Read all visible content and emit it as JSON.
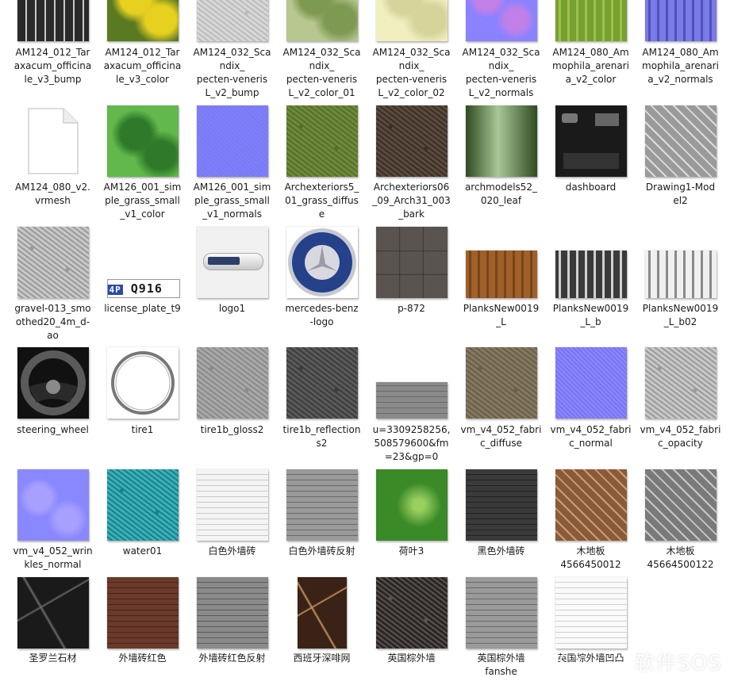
{
  "watermark": "软件SOS",
  "files": [
    {
      "n": "AM124_012_Taraxacum_officinale_v3_bump",
      "c": [
        "AM124_012_Tar",
        "axacum_officina",
        "le_v3_bump"
      ],
      "t": "dark",
      "th": [
        "#2a2a2a",
        "#c9c9c9"
      ]
    },
    {
      "n": "AM124_012_Taraxacum_officinale_v3_color",
      "c": [
        "AM124_012_Tar",
        "axacum_officina",
        "le_v3_color"
      ],
      "t": "leaf",
      "th": [
        "#5a7a22",
        "#e8d020"
      ]
    },
    {
      "n": "AM124_032_Scandix_pecten-veneris_L_v2_bump",
      "c": [
        "AM124_032_Sca",
        "ndix_",
        "pecten-veneris",
        "L_v2_bump"
      ],
      "t": "noise",
      "th": [
        "#d8d8d8",
        "#bcbcbc"
      ]
    },
    {
      "n": "AM124_032_Scandix_pecten-veneris_L_v2_color_01",
      "c": [
        "AM124_032_Sca",
        "ndix_",
        "pecten-veneris",
        "L_v2_color_01"
      ],
      "t": "leaf",
      "th": [
        "#b8c690",
        "#7e9a52"
      ]
    },
    {
      "n": "AM124_032_Scandix_pecten-veneris_L_v2_color_02",
      "c": [
        "AM124_032_Sca",
        "ndix_",
        "pecten-veneris",
        "L_v2_color_02"
      ],
      "t": "leaf",
      "th": [
        "#f1efc0",
        "#d6d49a"
      ]
    },
    {
      "n": "AM124_032_Scandix_pecten-veneris_L_v2_normals",
      "c": [
        "AM124_032_Sca",
        "ndix_",
        "pecten-veneris",
        "L_v2_normals"
      ],
      "t": "normal",
      "th": [
        "#8a82ff",
        "#c080e8"
      ]
    },
    {
      "n": "AM124_080_Ammophila_arenaria_v2_color",
      "c": [
        "AM124_080_Am",
        "mophila_arenari",
        "a_v2_color"
      ],
      "t": "stripes",
      "th": [
        "#78a030",
        "#9ac24a"
      ]
    },
    {
      "n": "AM124_080_Ammophila_arenaria_v2_normals",
      "c": [
        "AM124_080_Am",
        "mophila_arenari",
        "a_v2_normals"
      ],
      "t": "stripes",
      "th": [
        "#7a7ae8",
        "#5050b8"
      ]
    },
    {
      "n": "AM124_080_v2.vrmesh",
      "c": [
        "AM124_080_v2.",
        "vrmesh"
      ],
      "t": "file",
      "th": [
        "#ffffff",
        "#dddddd"
      ]
    },
    {
      "n": "AM126_001_simple_grass_small_v1_color",
      "c": [
        "AM126_001_sim",
        "ple_grass_small",
        "_v1_color"
      ],
      "t": "leaf",
      "th": [
        "#62b84a",
        "#2f7a2a"
      ]
    },
    {
      "n": "AM126_001_simple_grass_small_v1_normals",
      "c": [
        "AM126_001_sim",
        "ple_grass_small",
        "_v1_normals"
      ],
      "t": "flat",
      "th": [
        "#8080ff",
        "#7a7af2"
      ]
    },
    {
      "n": "Archexteriors5_01_grass_diffuse",
      "c": [
        "Archexteriors5_",
        "01_grass_diffus",
        "e"
      ],
      "t": "noise",
      "th": [
        "#6f8a3a",
        "#55702a"
      ]
    },
    {
      "n": "Archexteriors06_09_Arch31_003_bark",
      "c": [
        "Archexteriors06",
        "_09_Arch31_003",
        "_bark"
      ],
      "t": "noise",
      "th": [
        "#5b4a3e",
        "#3a2e26"
      ]
    },
    {
      "n": "archmodels52_020_leaf",
      "c": [
        "archmodels52_",
        "020_leaf"
      ],
      "t": "vgrad",
      "th": [
        "#2f4a20",
        "#a8c898"
      ]
    },
    {
      "n": "dashboard",
      "c": [
        "dashboard"
      ],
      "t": "dash",
      "th": [
        "#1a1a1a",
        "#444444"
      ]
    },
    {
      "n": "Drawing1-Model2",
      "c": [
        "Drawing1-Mod",
        "el2"
      ],
      "t": "parquet",
      "th": [
        "#9a9a9a",
        "#dcdcdc"
      ]
    },
    {
      "n": "gravel-013_smoothed20_4m_d-ao",
      "c": [
        "gravel-013_smo",
        "othed20_4m_d-",
        "ao"
      ],
      "t": "noise",
      "th": [
        "#c8c8c8",
        "#9a9a9a"
      ]
    },
    {
      "n": "license_plate_t9",
      "c": [
        "license_plate_t9"
      ],
      "t": "plate",
      "th": [
        "#ffffff",
        "#1a1a1a"
      ]
    },
    {
      "n": "logo1",
      "c": [
        "logo1"
      ],
      "t": "badge",
      "th": [
        "#f0f0f0",
        "#2c3e6a"
      ]
    },
    {
      "n": "mercedes-benz-logo",
      "c": [
        "mercedes-benz",
        "-logo"
      ],
      "t": "benz",
      "th": [
        "#24418a",
        "#c8c8d0"
      ]
    },
    {
      "n": "p-872",
      "c": [
        "p-872"
      ],
      "t": "tiles",
      "th": [
        "#5a5450",
        "#3a3432"
      ]
    },
    {
      "n": "PlanksNew0019_L",
      "c": [
        "PlanksNew0019",
        "_L"
      ],
      "t": "stripes",
      "th": [
        "#a0602a",
        "#7a4418"
      ],
      "h": 60
    },
    {
      "n": "PlanksNew0019_L_b",
      "c": [
        "PlanksNew0019",
        "_L_b"
      ],
      "t": "stripes",
      "th": [
        "#3a3a3a",
        "#d0d0d0"
      ],
      "h": 60
    },
    {
      "n": "PlanksNew0019_L_b02",
      "c": [
        "PlanksNew0019",
        "_L_b02"
      ],
      "t": "stripes",
      "th": [
        "#f0f0f0",
        "#8a8a8a"
      ],
      "h": 60
    },
    {
      "n": "steering_wheel",
      "c": [
        "steering_wheel"
      ],
      "t": "wheel",
      "th": [
        "#111111",
        "#5a5a5a"
      ]
    },
    {
      "n": "tire1",
      "c": [
        "tire1"
      ],
      "t": "ring",
      "th": [
        "#ffffff",
        "#777777"
      ]
    },
    {
      "n": "tire1b_gloss2",
      "c": [
        "tire1b_gloss2"
      ],
      "t": "noise",
      "th": [
        "#a8a8a8",
        "#8a8a8a"
      ]
    },
    {
      "n": "tire1b_reflections2",
      "c": [
        "tire1b_reflection",
        "s2"
      ],
      "t": "noise",
      "th": [
        "#5a5a5a",
        "#3c3c3c"
      ]
    },
    {
      "n": "u=3309258256,508579600&fm=23&gp=0",
      "c": [
        "u=3309258256,",
        "508579600&fm",
        "=23&gp=0"
      ],
      "t": "hlines",
      "th": [
        "#8a8a8a",
        "#6a6a6a"
      ],
      "h": 46
    },
    {
      "n": "vm_v4_052_fabric_diffuse",
      "c": [
        "vm_v4_052_fabri",
        "c_diffuse"
      ],
      "t": "noise",
      "th": [
        "#857862",
        "#6a5e4a"
      ]
    },
    {
      "n": "vm_v4_052_fabric_normal",
      "c": [
        "vm_v4_052_fabri",
        "c_normal"
      ],
      "t": "flat",
      "th": [
        "#8a86ff",
        "#7876ee"
      ]
    },
    {
      "n": "vm_v4_052_fabric_opacity",
      "c": [
        "vm_v4_052_fabri",
        "c_opacity"
      ],
      "t": "noise",
      "th": [
        "#c8c8c8",
        "#9a9a9a"
      ]
    },
    {
      "n": "vm_v4_052_wrinkles_normal",
      "c": [
        "vm_v4_052_wrin",
        "kles_normal"
      ],
      "t": "normal",
      "th": [
        "#8a88ff",
        "#a8a0ff"
      ]
    },
    {
      "n": "water01",
      "c": [
        "water01"
      ],
      "t": "noise",
      "th": [
        "#3ab0b8",
        "#1a8088"
      ]
    },
    {
      "n": "白色外墙砖",
      "c": [
        "白色外墙砖"
      ],
      "t": "hlines",
      "th": [
        "#f4f4f4",
        "#c8c8c8"
      ]
    },
    {
      "n": "白色外墙砖反射",
      "c": [
        "白色外墙砖反射"
      ],
      "t": "hlines",
      "th": [
        "#9a9a9a",
        "#6a6a6a"
      ]
    },
    {
      "n": "荷叶3",
      "c": [
        "荷叶3"
      ],
      "t": "lotus",
      "th": [
        "#3a8a28",
        "#9ad060"
      ]
    },
    {
      "n": "黑色外墙砖",
      "c": [
        "黑色外墙砖"
      ],
      "t": "hlines",
      "th": [
        "#3a3a3a",
        "#222222"
      ]
    },
    {
      "n": "木地板4566450012",
      "c": [
        "木地板",
        "4566450012"
      ],
      "t": "parquet",
      "th": [
        "#8a5a3a",
        "#c8a070"
      ]
    },
    {
      "n": "木地板45664500122",
      "c": [
        "木地板",
        "45664500122"
      ],
      "t": "parquet",
      "th": [
        "#7a7a7a",
        "#c8c8c8"
      ]
    },
    {
      "n": "圣罗兰石材",
      "c": [
        "圣罗兰石材"
      ],
      "t": "marble",
      "th": [
        "#1a1a1a",
        "#6a6a6a"
      ]
    },
    {
      "n": "外墙砖红色",
      "c": [
        "外墙砖红色"
      ],
      "t": "hlines",
      "th": [
        "#6a3a2a",
        "#4a2418"
      ]
    },
    {
      "n": "外墙砖红色反射",
      "c": [
        "外墙砖红色反射"
      ],
      "t": "hlines",
      "th": [
        "#8a8a8a",
        "#5a5a5a"
      ]
    },
    {
      "n": "西班牙深啡网",
      "c": [
        "西班牙深啡网"
      ],
      "t": "marble",
      "th": [
        "#3a2216",
        "#c89a60"
      ],
      "w": 62
    },
    {
      "n": "英国棕外墙",
      "c": [
        "英国棕外墙"
      ],
      "t": "noise",
      "th": [
        "#2a2624",
        "#5a5250"
      ]
    },
    {
      "n": "英国棕外墙fanshe",
      "c": [
        "英国棕外墙",
        "fanshe"
      ],
      "t": "hlines",
      "th": [
        "#9a9a9a",
        "#6a6a6a"
      ]
    },
    {
      "n": "英国棕外墙凹凸",
      "c": [
        "英国棕外墙凹凸"
      ],
      "t": "hlines",
      "th": [
        "#fafafa",
        "#cfcfcf"
      ]
    }
  ]
}
